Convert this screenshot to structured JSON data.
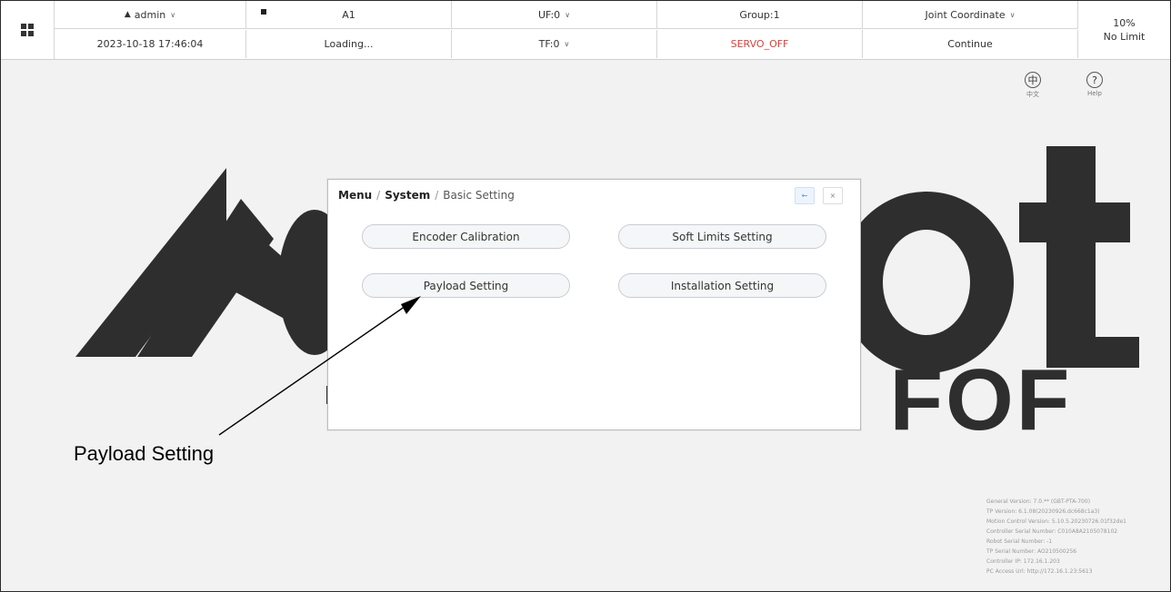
{
  "status_bar": {
    "user": "admin",
    "datetime": "2023-10-18 17:46:04",
    "program": "A1",
    "program_status": "Loading...",
    "user_frame": "UF:0",
    "tool_frame": "TF:0",
    "group": "Group:1",
    "servo_status": "SERVO_OFF",
    "coordinate": "Joint Coordinate",
    "run_mode": "Continue",
    "speed": "10%",
    "limit": "No Limit",
    "colors": {
      "servo_off": "#d9423d"
    }
  },
  "tools": {
    "language_label": "中文",
    "language_glyph": "中",
    "help_label": "Help",
    "help_glyph": "?"
  },
  "background": {
    "brand": "Aobot",
    "slogan": "Drive the FOF"
  },
  "version_info": {
    "lines": [
      "General Version:  7.0.** (GBT-PTA-700)",
      "TP Version:  6.1.08(20230926.dc668c1a3)",
      "Motion Control Version:  5.10.5.20230726.01f32de1",
      "Controller Serial Number:  C010A8A2105078102",
      "Robot Serial Number:  -1",
      "TP Serial Number:  AO210500256",
      "Controller IP:  172.16.1.203",
      "PC Access Url:  http://172.16.1.23:5613"
    ]
  },
  "dialog": {
    "breadcrumb": [
      "Menu",
      "System",
      "Basic Setting"
    ],
    "back_glyph": "←",
    "close_glyph": "×",
    "buttons": [
      "Encoder Calibration",
      "Soft Limits Setting",
      "Payload Setting",
      "Installation Setting"
    ]
  },
  "annotation": {
    "label": "Payload Setting"
  }
}
